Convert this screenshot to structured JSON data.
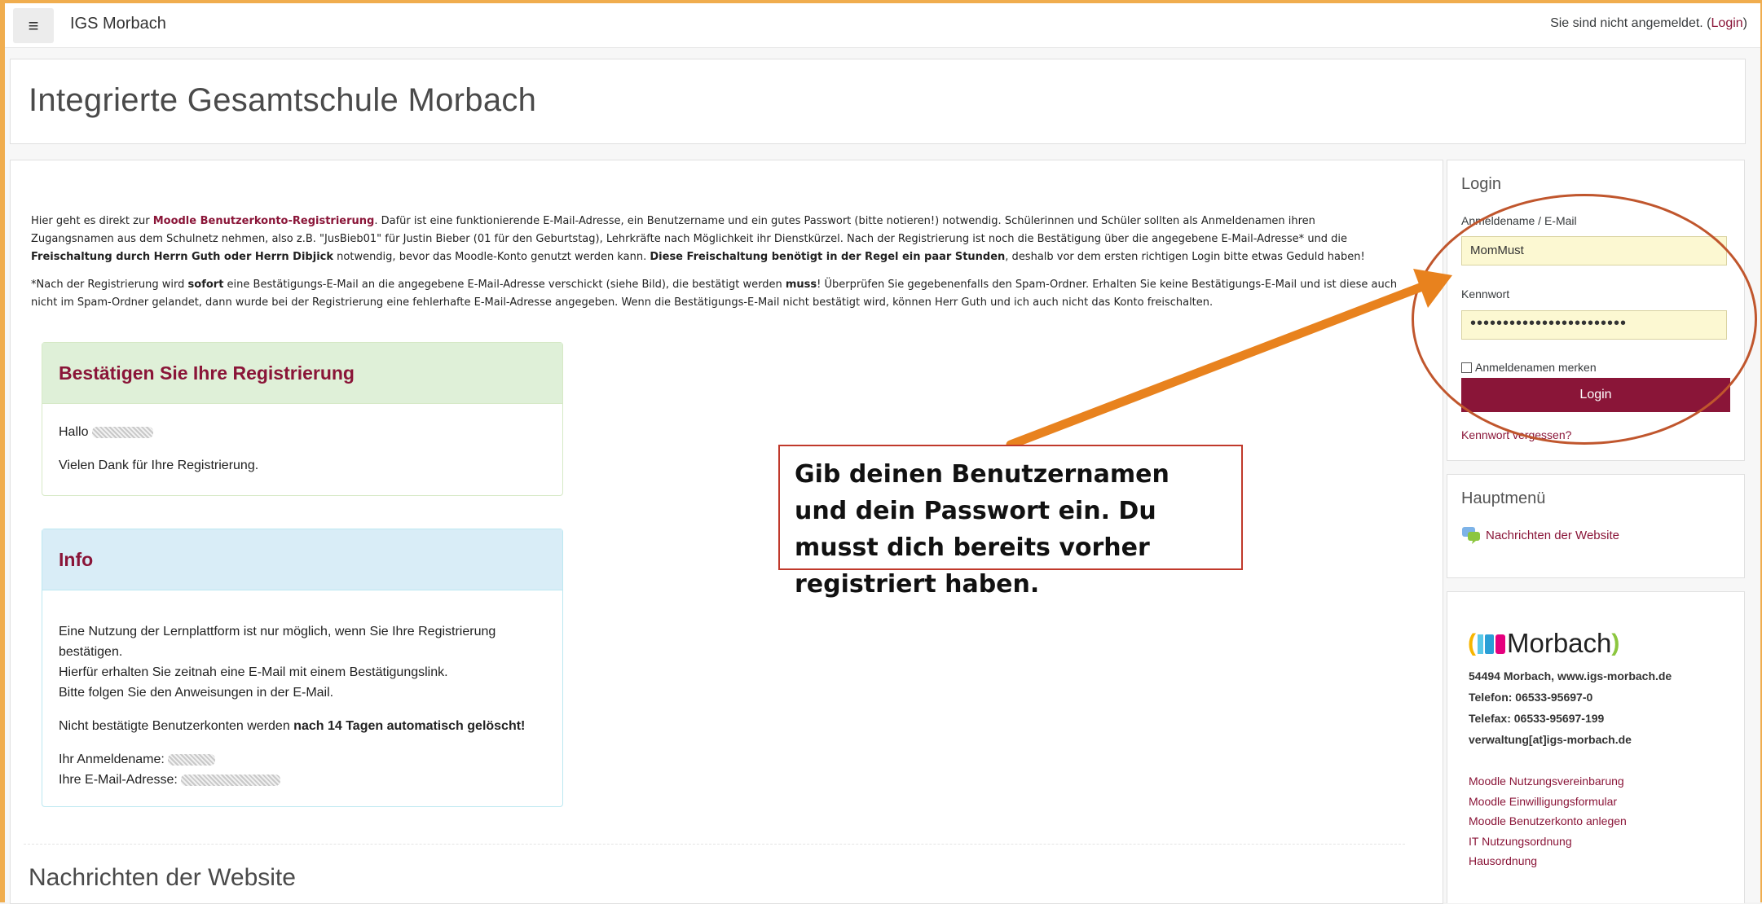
{
  "navbar": {
    "menu_icon": "hamburger-icon",
    "brand": "IGS Morbach",
    "status_text": "Sie sind nicht angemeldet. (",
    "login_link": "Login",
    "status_end": ")"
  },
  "header": {
    "title": "Integrierte Gesamtschule Morbach"
  },
  "intro": {
    "p1_a": "Hier geht es direkt zur ",
    "p1_link": "Moodle Benutzerkonto-Registrierung",
    "p1_b": ". Dafür ist eine funktionierende E-Mail-Adresse, ein Benutzername und ein gutes Passwort (bitte notieren!) notwendig. Schülerinnen und Schüler sollten als Anmeldenamen ihren Zugangsnamen aus dem Schulnetz nehmen, also z.B. \"JusBieb01\" für Justin Bieber (01 für den Geburtstag), Lehrkräfte nach Möglichkeit ihr Dienstkürzel. Nach der Registrierung ist noch die Bestätigung über die angegebene E-Mail-Adresse* und die ",
    "p1_bold1": "Freischaltung durch Herrn Guth oder Herrn Dibjick",
    "p1_c": " notwendig, bevor das Moodle-Konto genutzt werden kann. ",
    "p1_bold2": "Diese Freischaltung benötigt in der Regel ein paar Stunden",
    "p1_d": ", deshalb vor dem ersten richtigen Login bitte etwas Geduld haben!",
    "p2_a": "*Nach der Registrierung wird ",
    "p2_bold1": "sofort",
    "p2_b": " eine Bestätigungs-E-Mail an die angegebene E-Mail-Adresse verschickt (siehe Bild), die bestätigt werden ",
    "p2_bold2": "muss",
    "p2_c": "! Überprüfen Sie gegebenenfalls den Spam-Ordner. Erhalten Sie keine Bestätigungs-E-Mail und ist diese auch nicht im Spam-Ordner gelandet, dann wurde bei der Registrierung eine fehlerhafte E-Mail-Adresse angegeben. Wenn die Bestätigungs-E-Mail nicht bestätigt wird, können Herr Guth und ich auch nicht das Konto freischalten."
  },
  "confirm_card": {
    "title": "Bestätigen Sie Ihre Registrierung",
    "greeting": "Hallo",
    "thanks": "Vielen Dank für Ihre Registrierung."
  },
  "info_card": {
    "title": "Info",
    "line1": "Eine Nutzung der Lernplattform ist nur möglich, wenn Sie Ihre Registrierung bestätigen.",
    "line2": "Hierfür erhalten Sie zeitnah eine E-Mail mit einem Bestätigungslink.",
    "line3": "Bitte folgen Sie den Anweisungen in der E-Mail.",
    "warn_a": "Nicht bestätigte Benutzerkonten werden ",
    "warn_bold": "nach 14 Tagen automatisch gelöscht!",
    "user_label": "Ihr Anmeldename:",
    "email_label": "Ihre E-Mail-Adresse:"
  },
  "news": {
    "title": "Nachrichten der Website"
  },
  "login_block": {
    "title": "Login",
    "username_label": "Anmeldename / E-Mail",
    "username_value": "MomMust",
    "password_label": "Kennwort",
    "password_value": "••••••••••••••••••••••••",
    "remember_label": "Anmeldenamen merken",
    "login_button": "Login",
    "forgot_link": "Kennwort vergessen?"
  },
  "menu_block": {
    "title": "Hauptmenü",
    "item_icon": "news-icon",
    "item": "Nachrichten der Website"
  },
  "footer_block": {
    "logo_text": "Morbach",
    "address": "54494 Morbach, www.igs-morbach.de",
    "phone": "Telefon: 06533-95697-0",
    "fax": "Telefax: 06533-95697-199",
    "email": "verwaltung[at]igs-morbach.de",
    "links": [
      "Moodle Nutzungsvereinbarung",
      "Moodle Einwilligungsformular",
      "Moodle Benutzerkonto anlegen",
      "IT Nutzungsordnung",
      "Hausordnung"
    ]
  },
  "annotation": {
    "text": "Gib deinen Benutzernamen und dein Passwort ein. Du musst dich bereits vorher registriert haben.",
    "colors": {
      "arrow": "#e8821e",
      "ellipse": "#c0562d",
      "box_border": "#c0392b"
    }
  },
  "colors": {
    "accent": "#8a1538",
    "frame": "#f0ad4e"
  }
}
